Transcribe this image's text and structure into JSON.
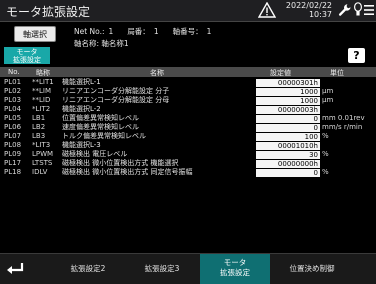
{
  "window": {
    "title": "モータ拡張設定"
  },
  "status": {
    "date": "2022/02/22",
    "time": "10:37"
  },
  "header": {
    "axis_button": "軸選択",
    "motor_button_line1": "モータ",
    "motor_button_line2": "拡張設定",
    "net_no_label": "Net No.:",
    "net_no_value": "1",
    "station_label": "局番：",
    "station_value": "1",
    "axis_no_label": "軸番号：",
    "axis_no_value": "1",
    "axis_name": "軸名称: 軸名称1",
    "help": "?"
  },
  "table": {
    "headers": {
      "no": "No.",
      "symbol": "略称",
      "name": "名称",
      "value": "設定値",
      "unit": "単位"
    },
    "rows": [
      {
        "no": "PL01",
        "symbol": "**LIT1",
        "name": "機能選択L-1",
        "value": "00000301h",
        "unit": ""
      },
      {
        "no": "PL02",
        "symbol": "**LIM",
        "name": "リニアエンコーダ分解能設定 分子",
        "value": "1000",
        "unit": "μm"
      },
      {
        "no": "PL03",
        "symbol": "**LID",
        "name": "リニアエンコーダ分解能設定 分母",
        "value": "1000",
        "unit": "μm"
      },
      {
        "no": "PL04",
        "symbol": "*LIT2",
        "name": "機能選択L-2",
        "value": "00000003h",
        "unit": ""
      },
      {
        "no": "PL05",
        "symbol": "LB1",
        "name": "位置偏差異常検知レベル",
        "value": "0",
        "unit": "mm 0.01rev"
      },
      {
        "no": "PL06",
        "symbol": "LB2",
        "name": "速度偏差異常検知レベル",
        "value": "0",
        "unit": "mm/s r/min"
      },
      {
        "no": "PL07",
        "symbol": "LB3",
        "name": "トルク偏差異常検知レベル",
        "value": "100",
        "unit": "%"
      },
      {
        "no": "PL08",
        "symbol": "*LIT3",
        "name": "機能選択L-3",
        "value": "00001010h",
        "unit": ""
      },
      {
        "no": "PL09",
        "symbol": "LPWM",
        "name": "磁極検出 電圧レベル",
        "value": "30",
        "unit": "%"
      },
      {
        "no": "PL17",
        "symbol": "LTSTS",
        "name": "磁極検出 微小位置検出方式 機能選択",
        "value": "00000000h",
        "unit": ""
      },
      {
        "no": "PL18",
        "symbol": "IDLV",
        "name": "磁極検出 微小位置検出方式 同定信号振幅",
        "value": "0",
        "unit": "%"
      }
    ]
  },
  "footer": {
    "tabs": [
      {
        "label": "拡張設定2"
      },
      {
        "label": "拡張設定3"
      },
      {
        "label_line1": "モータ",
        "label_line2": "拡張設定",
        "active": true
      },
      {
        "label": "位置決め制御"
      }
    ]
  }
}
